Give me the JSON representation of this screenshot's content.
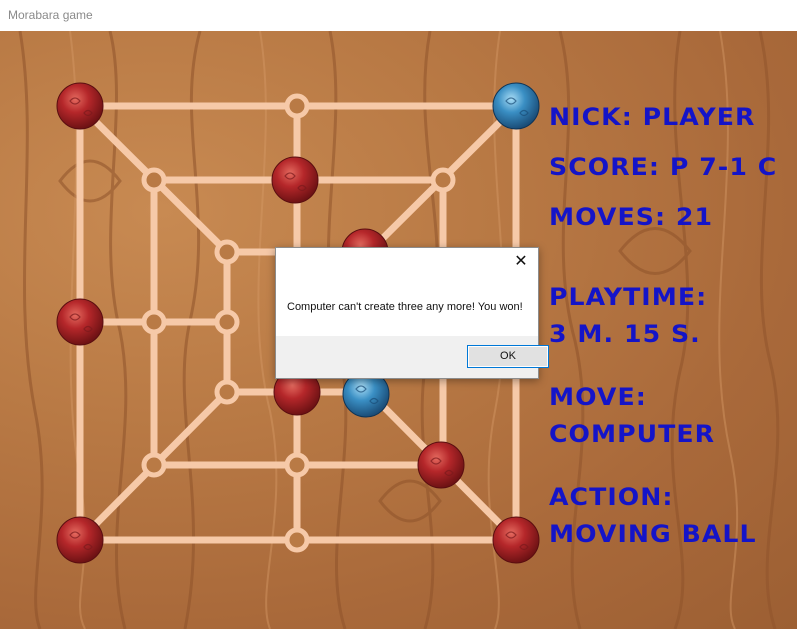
{
  "window": {
    "title": "Morabara game"
  },
  "info": {
    "nick": "NICK: PLAYER",
    "score": "SCORE: P 7-1 C",
    "moves": "MOVES: 21",
    "playtime_label": "PLAYTIME:",
    "playtime_value": "3 M. 15 S.",
    "move_label": "MOVE:",
    "move_value": "COMPUTER",
    "action_label": "ACTION:",
    "action_value": "MOVING BALL"
  },
  "dialog": {
    "message": "Computer can't create three any more! You won!",
    "ok_label": "OK",
    "close_glyph": "✕"
  },
  "colors": {
    "player_ball": "#b5272a",
    "computer_ball": "#3a8fc4",
    "lines": "#f6c9a8",
    "text": "#1414c8"
  },
  "board": {
    "red_balls": 9,
    "blue_balls": 2
  }
}
